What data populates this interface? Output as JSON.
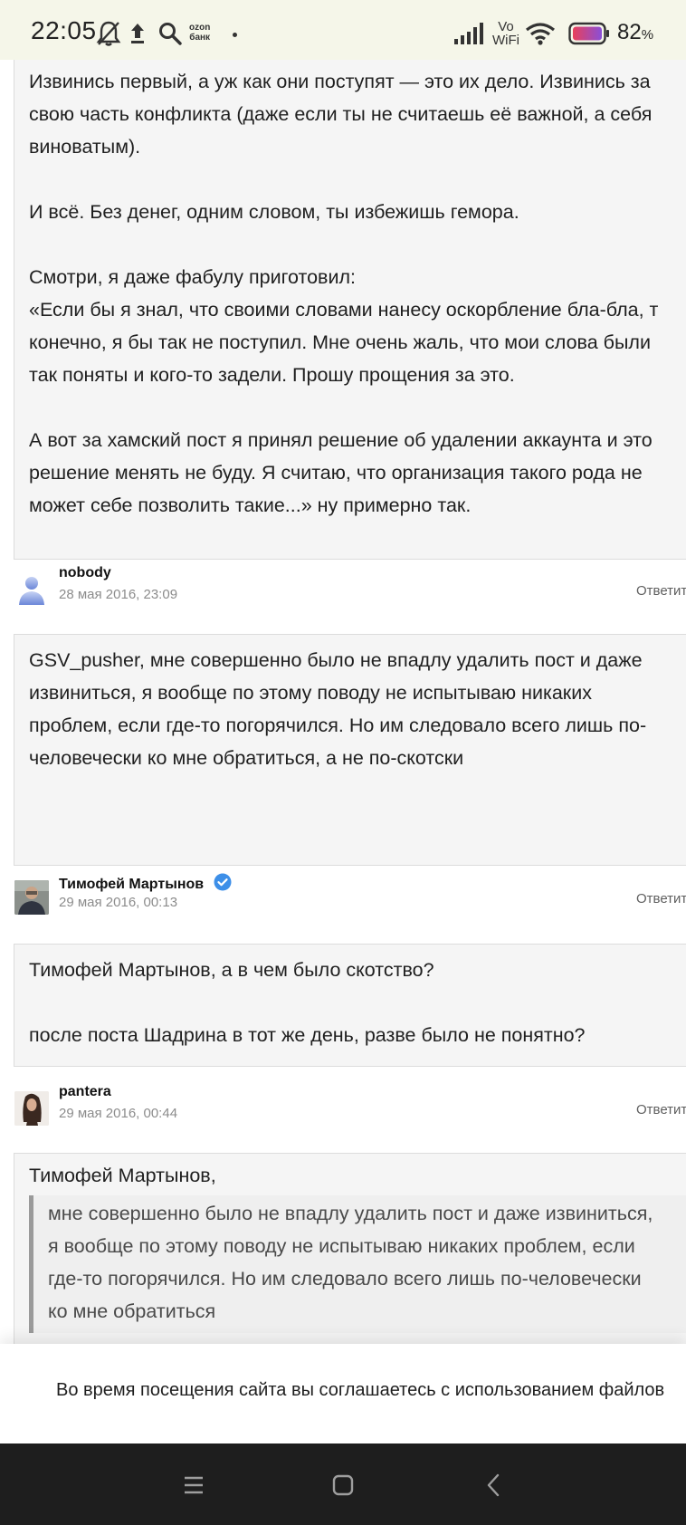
{
  "status_bar": {
    "time": "22:05",
    "battery_percent": "82",
    "battery_suffix": "%",
    "ozon_label_top": "ozon",
    "ozon_label_bottom": "банк",
    "volte_top": "Vo",
    "volte_bottom": "WiFi"
  },
  "posts": [
    {
      "lines": [
        "Извинись первый, а уж как они поступят — это их дело. Извинись за",
        "свою часть конфликта (даже если ты не считаешь её важной, а себя",
        "виноватым).",
        "",
        "И всё. Без денег, одним словом, ты избежишь гемора.",
        "",
        "Смотри, я даже фабулу приготовил:",
        "«Если бы я знал, что своими словами нанесу оскорбление бла-бла, т",
        "конечно, я бы так не поступил. Мне очень жаль, что мои слова были",
        "так поняты и кого-то задели. Прошу прощения за это.",
        "",
        "А вот за хамский пост я принял решение об удалении аккаунта и это",
        "решение менять не буду. Я считаю, что организация такого рода не",
        "может себе позволить такие...» ну примерно так."
      ],
      "author": "nobody",
      "date": "28 мая 2016, 23:09",
      "reply": "Ответить"
    },
    {
      "lines": [
        "GSV_pusher, мне совершенно было не впадлу удалить пост и даже",
        "извиниться, я вообще по этому поводу не испытываю никаких",
        "проблем, если где-то погорячился. Но им следовало всего лишь по-",
        "человечески ко мне обратиться, а не по-скотски"
      ],
      "author": "Тимофей Мартынов",
      "date": "29 мая 2016, 00:13",
      "reply": "Ответить"
    },
    {
      "lines": [
        "Тимофей Мартынов, а в чем было скотство?",
        "",
        "после поста Шадрина в тот же день, разве было не понятно?"
      ],
      "author": "pantera",
      "date": "29 мая 2016, 00:44",
      "reply": "Ответить"
    },
    {
      "lines": [
        "Тимофей Мартынов,"
      ],
      "quote": [
        "мне совершенно было не впадлу удалить пост и даже извиниться,",
        "я вообще по этому поводу не испытываю никаких проблем, если",
        "где-то погорячился. Но им следовало всего лишь по-человечески",
        "ко мне обратиться"
      ]
    }
  ],
  "cookie_banner": {
    "text": "Во время посещения сайта вы соглашаетесь с использованием файлов"
  },
  "colors": {
    "status_bg": "#f5f6e9",
    "post_bg": "#f5f5f5",
    "post_border": "#dcdcdc",
    "date_gray": "#8c8c8c",
    "verified_blue": "#3d8fe8",
    "navbar_bg": "#1e1e1e"
  },
  "icons": {
    "status": [
      "dnd-bell-off-icon",
      "upload-icon",
      "search-icon",
      "ozon-bank-icon",
      "dot-icon",
      "signal-icon",
      "vowifi-icon",
      "wifi-icon",
      "battery-icon"
    ],
    "nav": [
      "menu-icon",
      "home-icon",
      "back-icon"
    ]
  }
}
